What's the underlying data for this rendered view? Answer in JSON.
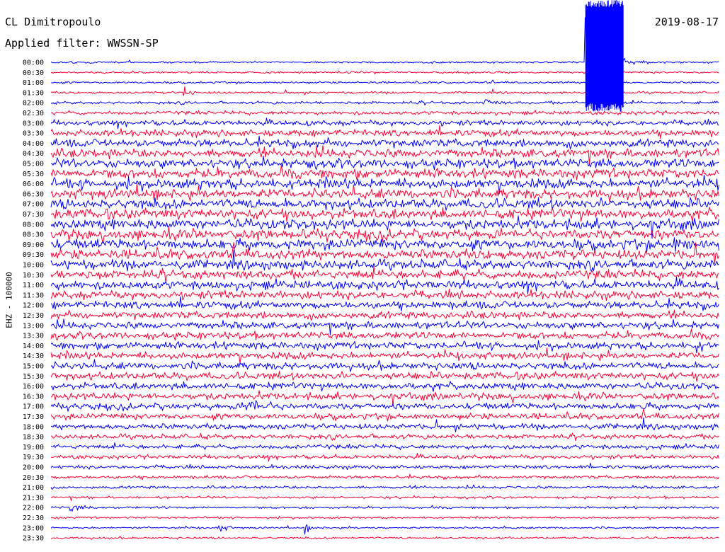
{
  "header": {
    "station": "CL Dimitropoulo",
    "filter_label": "Applied filter:",
    "filter_value": "WWSSN-SP",
    "date": "2019-08-17"
  },
  "chart_data": {
    "type": "line",
    "subtype": "helicorder",
    "y_axis_label": "EHZ - 100000",
    "row_labels": [
      "00:00",
      "00:30",
      "01:00",
      "01:30",
      "02:00",
      "02:30",
      "03:00",
      "03:30",
      "04:00",
      "04:30",
      "05:00",
      "05:30",
      "06:00",
      "06:30",
      "07:00",
      "07:30",
      "08:00",
      "08:30",
      "09:00",
      "09:30",
      "10:00",
      "10:30",
      "11:00",
      "11:30",
      "12:00",
      "12:30",
      "13:00",
      "13:30",
      "14:00",
      "14:30",
      "15:00",
      "15:30",
      "16:00",
      "16:30",
      "17:00",
      "17:30",
      "18:00",
      "18:30",
      "19:00",
      "19:30",
      "20:00",
      "20:30",
      "21:00",
      "21:30",
      "22:00",
      "22:30",
      "23:00",
      "23:30"
    ],
    "trace_colors": [
      "#0000ff",
      "#ff0033"
    ],
    "color_pattern": "alternating by row, starting blue",
    "row_noise_level": [
      0.22,
      0.25,
      0.25,
      0.28,
      0.35,
      0.45,
      0.65,
      0.85,
      1.0,
      1.1,
      1.15,
      1.2,
      1.25,
      1.25,
      1.25,
      1.25,
      1.25,
      1.25,
      1.25,
      1.2,
      1.15,
      1.1,
      1.05,
      1.0,
      0.95,
      0.9,
      0.9,
      0.9,
      0.9,
      0.9,
      0.9,
      0.9,
      0.85,
      0.85,
      0.8,
      0.75,
      0.7,
      0.6,
      0.55,
      0.5,
      0.45,
      0.4,
      0.35,
      0.3,
      0.28,
      0.25,
      0.25,
      0.25
    ],
    "events": [
      {
        "row_label": "00:00",
        "minute": 24.0,
        "amplitude": 10.0,
        "duration_min": 1.7,
        "note": "clipped burst extending above first trace"
      },
      {
        "row_label": "01:30",
        "minute": 6.0,
        "amplitude": 1.6,
        "duration_min": 0.5
      },
      {
        "row_label": "02:00",
        "minute": 19.5,
        "amplitude": 1.4,
        "duration_min": 0.6
      },
      {
        "row_label": "09:00",
        "minute": 28.0,
        "amplitude": 1.6,
        "duration_min": 1.0
      },
      {
        "row_label": "14:00",
        "minute": 29.0,
        "amplitude": 1.4,
        "duration_min": 0.6
      },
      {
        "row_label": "17:00",
        "minute": 8.8,
        "amplitude": 2.6,
        "duration_min": 1.2
      },
      {
        "row_label": "22:00",
        "minute": 0.9,
        "amplitude": 1.4,
        "duration_min": 0.8
      },
      {
        "row_label": "23:00",
        "minute": 7.5,
        "amplitude": 1.4,
        "duration_min": 0.7
      },
      {
        "row_label": "23:00",
        "minute": 11.4,
        "amplitude": 1.3,
        "duration_min": 0.5
      }
    ]
  }
}
